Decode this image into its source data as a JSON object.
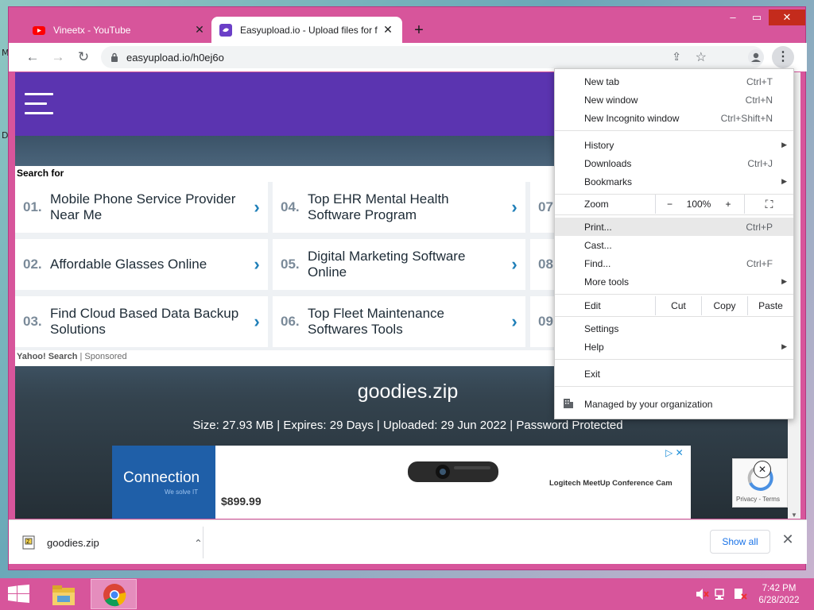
{
  "desktop": {
    "glyph_m": "M",
    "glyph_d": "D"
  },
  "tabs": [
    {
      "title": "Vineetx - YouTube",
      "icon": "youtube-icon"
    },
    {
      "title": "Easyupload.io - Upload files for f",
      "icon": "easyupload-icon"
    }
  ],
  "window_controls": {
    "minimize": "–",
    "maximize": "▭",
    "close": "✕"
  },
  "toolbar": {
    "url": "easyupload.io/h0ej6o"
  },
  "search": {
    "heading": "Search for",
    "items": [
      {
        "num": "01.",
        "text": "Mobile Phone Service Provider Near Me"
      },
      {
        "num": "02.",
        "text": "Affordable Glasses Online"
      },
      {
        "num": "03.",
        "text": "Find Cloud Based Data Backup Solutions"
      },
      {
        "num": "04.",
        "text": "Top EHR Mental Health Software Program"
      },
      {
        "num": "05.",
        "text": "Digital Marketing Software Online"
      },
      {
        "num": "06.",
        "text": "Top Fleet Maintenance Softwares Tools"
      },
      {
        "num": "07",
        "text": ""
      },
      {
        "num": "08",
        "text": ""
      },
      {
        "num": "09",
        "text": ""
      }
    ],
    "footer_brand": "Yahoo! Search",
    "footer_sep": "|",
    "footer_label": "Sponsored"
  },
  "file": {
    "name": "goodies.zip",
    "info": "Size: 27.93 MB | Expires: 29 Days | Uploaded: 29 Jun 2022 | Password Protected"
  },
  "ad": {
    "brand": "Connection",
    "tagline": "We solve IT",
    "price": "$899.99",
    "product": "Logitech MeetUp Conference Cam"
  },
  "captcha": {
    "links": "Privacy - Terms"
  },
  "menu": {
    "new_tab": {
      "label": "New tab",
      "shortcut": "Ctrl+T"
    },
    "new_window": {
      "label": "New window",
      "shortcut": "Ctrl+N"
    },
    "incognito": {
      "label": "New Incognito window",
      "shortcut": "Ctrl+Shift+N"
    },
    "history": {
      "label": "History"
    },
    "downloads": {
      "label": "Downloads",
      "shortcut": "Ctrl+J"
    },
    "bookmarks": {
      "label": "Bookmarks"
    },
    "zoom": {
      "label": "Zoom",
      "minus": "−",
      "value": "100%",
      "plus": "+"
    },
    "print": {
      "label": "Print...",
      "shortcut": "Ctrl+P"
    },
    "cast": {
      "label": "Cast..."
    },
    "find": {
      "label": "Find...",
      "shortcut": "Ctrl+F"
    },
    "more_tools": {
      "label": "More tools"
    },
    "edit": {
      "label": "Edit",
      "cut": "Cut",
      "copy": "Copy",
      "paste": "Paste"
    },
    "settings": {
      "label": "Settings"
    },
    "help": {
      "label": "Help"
    },
    "exit": {
      "label": "Exit"
    },
    "managed": {
      "label": "Managed by your organization"
    }
  },
  "download_bar": {
    "file": "goodies.zip",
    "show_all": "Show all"
  },
  "taskbar": {
    "time": "7:42 PM",
    "date": "6/28/2022"
  }
}
